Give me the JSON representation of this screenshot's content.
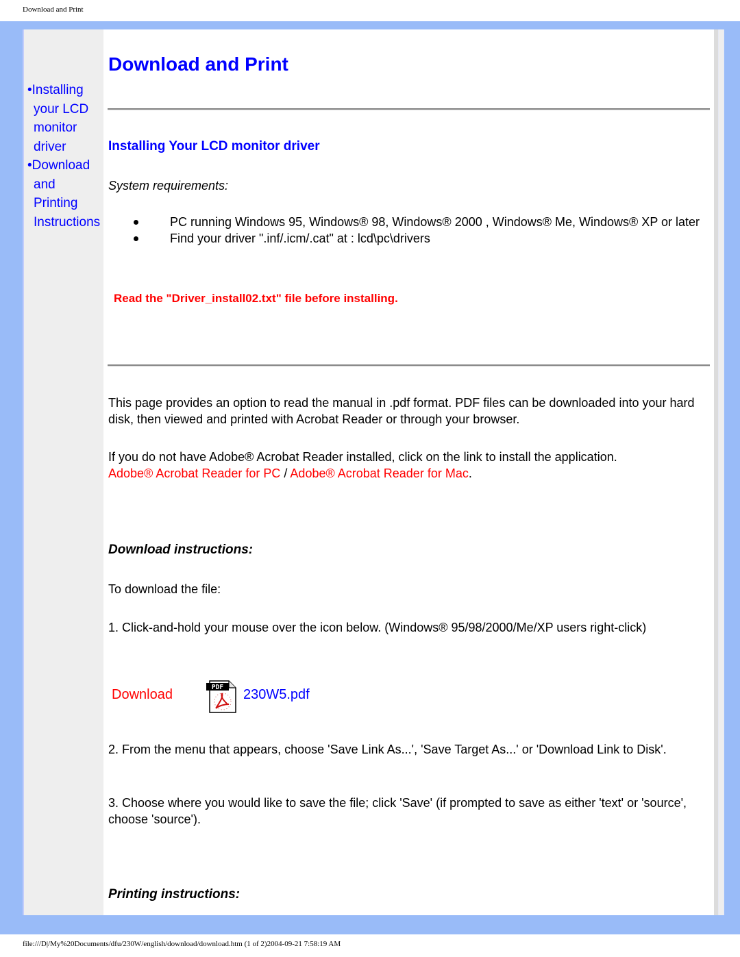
{
  "print_header": "Download and Print",
  "print_footer": "file:///D|/My%20Documents/dfu/230W/english/download/download.htm (1 of 2)2004-09-21 7:58:19 AM",
  "nav": {
    "items": [
      {
        "bullet": "•",
        "lines": [
          "Installing",
          "your LCD",
          "monitor",
          "driver"
        ]
      },
      {
        "bullet": "•",
        "lines": [
          "Download",
          "and",
          "Printing",
          "Instructions"
        ]
      }
    ]
  },
  "page_title": "Download and Print",
  "driver_section": {
    "title": "Installing Your LCD monitor driver",
    "sysreq_label": "System requirements:",
    "requirements": [
      "PC running Windows 95, Windows® 98, Windows® 2000 , Windows® Me, Windows® XP or later",
      "Find your driver \".inf/.icm/.cat\" at : lcd\\pc\\drivers"
    ],
    "warning": "Read the \"Driver_install02.txt\" file before installing."
  },
  "pdf_section": {
    "intro": "This page provides an option to read the manual in .pdf format. PDF files can be downloaded into your hard disk, then viewed and printed with Acrobat Reader or through your browser.",
    "acrobat_text": "If you do not have Adobe® Acrobat Reader installed, click on the link to install the application.",
    "acrobat_pc_link": "Adobe® Acrobat Reader for PC",
    "link_separator": " / ",
    "acrobat_mac_link": "Adobe® Acrobat Reader for Mac",
    "link_end": "."
  },
  "download_instructions": {
    "heading": "Download instructions:",
    "lead": "To download the file:",
    "step1": "1. Click-and-hold your mouse over the icon below. (Windows® 95/98/2000/Me/XP users right-click)",
    "download_label": "Download",
    "pdf_icon": "pdf-file-icon",
    "pdf_icon_text": "PDF",
    "pdf_filename": "230W5.pdf",
    "step2": "2. From the menu that appears, choose 'Save Link As...', 'Save Target As...' or 'Download Link to Disk'.",
    "step3": "3. Choose where you would like to save the file; click 'Save' (if prompted to save as either 'text' or 'source', choose 'source')."
  },
  "printing_instructions": {
    "heading": "Printing instructions:"
  }
}
